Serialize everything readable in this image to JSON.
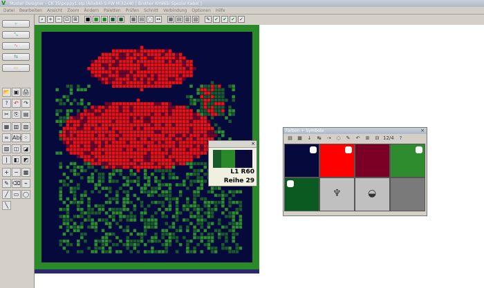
{
  "app": {
    "title": "Muster Designer - CK 35\\poppy1.stp (60x84)-S-FW   M:32x40   [ Brother KH965i Spezial Kabel ]"
  },
  "menu": [
    "Datei",
    "Bearbeiten",
    "Ansicht",
    "Zoom",
    "Ändern",
    "Paletten",
    "Prüfen",
    "Schnitt",
    "Verbindung",
    "Optionen",
    "Hilfe"
  ],
  "toolbar": {
    "icons": [
      "magnify-icon",
      "zoom-in-icon",
      "zoom-out-icon",
      "zoom-fit-icon",
      "zoom-area-icon",
      "color-1-icon",
      "color-2-icon",
      "color-3-icon",
      "color-4-icon",
      "color-5-icon",
      "grid-icon",
      "swatch-icon",
      "lasso-icon",
      "measure-icon",
      "table-icon",
      "grid2-icon",
      "symbols-icon",
      "rows-icon",
      "edit-icon",
      "check-green-icon",
      "check-green-2-icon",
      "check-green-3-icon",
      "check-icon"
    ]
  },
  "left_panel": {
    "buttons": [
      {
        "name": "knit-tool-1-button",
        "glyph": "⫟"
      },
      {
        "name": "knit-tool-2-button",
        "glyph": "⤡"
      },
      {
        "name": "knit-tool-3-button",
        "glyph": "∿"
      },
      {
        "name": "knit-tool-4-button",
        "glyph": "⇆"
      },
      {
        "name": "knit-tool-5-button",
        "glyph": "▭"
      }
    ],
    "tools": [
      "📂",
      "▣",
      "🖨",
      "?",
      "↶",
      "↷",
      "✂",
      "⎘",
      "▤",
      "▦",
      "▥",
      "▧",
      "≈",
      "Abc",
      "⁘",
      "▨",
      "◫",
      "◪",
      "ǀ",
      "◧",
      "◩",
      "+",
      "−",
      "▩",
      "✎",
      "⌫",
      "⌁",
      "╱",
      "▭",
      "◯",
      "╲"
    ]
  },
  "popup": {
    "text1": "L1 R60",
    "text2": "Reihe 29",
    "swatches": [
      "#1a5a2a",
      "#2a8a2a",
      "#0a0a3a"
    ]
  },
  "palette": {
    "title": "Farben + Symbole",
    "toolbar_icons": [
      "▤",
      "▦",
      "↓",
      "↹",
      "⇢",
      "◌",
      "✎",
      "↶",
      "⊞",
      "⊟",
      "12/4",
      "?"
    ],
    "cells": [
      {
        "color": "#06093c",
        "mark": true
      },
      {
        "color": "#ff0000",
        "mark": true
      },
      {
        "color": "#7a0026",
        "mark": false
      },
      {
        "color": "#2e8b2e",
        "mark": true
      },
      {
        "color": "#0a5a22",
        "mark": true
      },
      {
        "color": "#c0c0c0",
        "mark": false
      },
      {
        "color": "#c0c0c0",
        "mark": false
      },
      {
        "color": "#7a7a7a",
        "mark": false
      }
    ]
  },
  "colors": {
    "background": "#06093c",
    "dark_green": "#1a5a2a",
    "green": "#2e8b2e",
    "red": "#ee1010",
    "dark_red": "#7a0026",
    "border": "#2a8a2a"
  }
}
